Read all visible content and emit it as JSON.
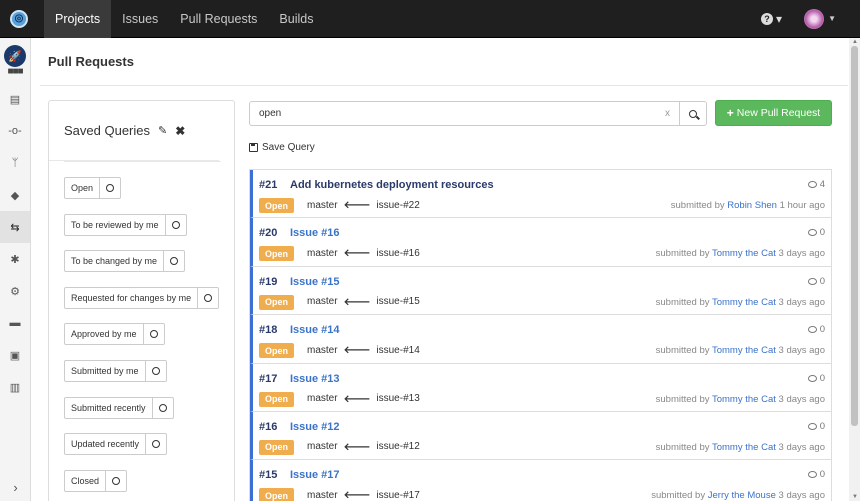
{
  "nav": {
    "tabs": [
      "Projects",
      "Issues",
      "Pull Requests",
      "Builds"
    ]
  },
  "page": {
    "title": "Pull Requests"
  },
  "saved_queries": {
    "title": "Saved Queries",
    "items": [
      "Open",
      "To be reviewed by me",
      "To be changed by me",
      "Requested for changes by me",
      "Approved by me",
      "Submitted by me",
      "Submitted recently",
      "Updated recently",
      "Closed"
    ]
  },
  "search": {
    "value": "open",
    "clear": "x"
  },
  "actions": {
    "new_pr": "New Pull Request",
    "save_query": "Save Query"
  },
  "pull_requests": [
    {
      "number": "#21",
      "title": "Add kubernetes deployment resources",
      "comments": "4",
      "status": "Open",
      "target": "master",
      "source": "issue-#22",
      "submitted_prefix": "submitted by",
      "user": "Robin Shen",
      "time": "1 hour ago"
    },
    {
      "number": "#20",
      "title": "Issue #16",
      "comments": "0",
      "status": "Open",
      "target": "master",
      "source": "issue-#16",
      "submitted_prefix": "submitted by",
      "user": "Tommy the Cat",
      "time": "3 days ago"
    },
    {
      "number": "#19",
      "title": "Issue #15",
      "comments": "0",
      "status": "Open",
      "target": "master",
      "source": "issue-#15",
      "submitted_prefix": "submitted by",
      "user": "Tommy the Cat",
      "time": "3 days ago"
    },
    {
      "number": "#18",
      "title": "Issue #14",
      "comments": "0",
      "status": "Open",
      "target": "master",
      "source": "issue-#14",
      "submitted_prefix": "submitted by",
      "user": "Tommy the Cat",
      "time": "3 days ago"
    },
    {
      "number": "#17",
      "title": "Issue #13",
      "comments": "0",
      "status": "Open",
      "target": "master",
      "source": "issue-#13",
      "submitted_prefix": "submitted by",
      "user": "Tommy the Cat",
      "time": "3 days ago"
    },
    {
      "number": "#16",
      "title": "Issue #12",
      "comments": "0",
      "status": "Open",
      "target": "master",
      "source": "issue-#12",
      "submitted_prefix": "submitted by",
      "user": "Tommy the Cat",
      "time": "3 days ago"
    },
    {
      "number": "#15",
      "title": "Issue #17",
      "comments": "0",
      "status": "Open",
      "target": "master",
      "source": "issue-#17",
      "submitted_prefix": "submitted by",
      "user": "Jerry the Mouse",
      "time": "3 days ago"
    }
  ],
  "colors": {
    "accent": "#3b6fd6",
    "open_badge": "#f0ad4e",
    "new_button": "#5cb85c"
  }
}
